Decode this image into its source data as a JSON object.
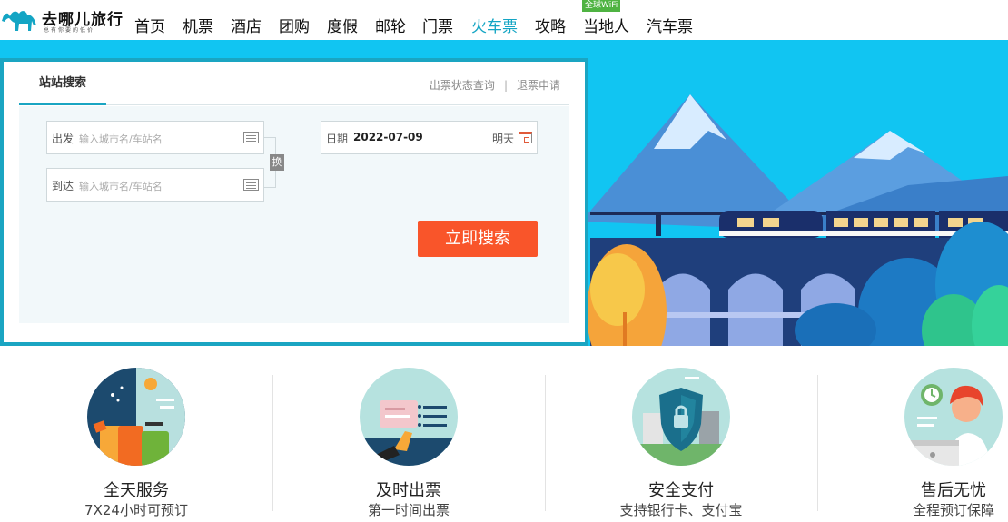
{
  "brand": {
    "name": "去哪儿旅行",
    "slogan": "总有你要的低价"
  },
  "nav": {
    "items": [
      {
        "label": "首页"
      },
      {
        "label": "机票"
      },
      {
        "label": "酒店"
      },
      {
        "label": "团购"
      },
      {
        "label": "度假"
      },
      {
        "label": "邮轮"
      },
      {
        "label": "门票"
      },
      {
        "label": "火车票",
        "active": true
      },
      {
        "label": "攻略"
      },
      {
        "label": "当地人"
      },
      {
        "label": "汽车票"
      }
    ],
    "badge": "全球WiFi"
  },
  "search": {
    "tab_label": "站站搜索",
    "link_status": "出票状态查询",
    "link_separator": "|",
    "link_refund": "退票申请",
    "depart_label": "出发",
    "depart_placeholder": "输入城市名/车站名",
    "arrive_label": "到达",
    "arrive_placeholder": "输入城市名/车站名",
    "swap_label": "换",
    "date_label": "日期",
    "date_value": "2022-07-09",
    "date_tag": "明天",
    "search_button": "立即搜索"
  },
  "features": [
    {
      "title": "全天服务",
      "subtitle": "7X24小时可预订",
      "icon": "luggage-icon"
    },
    {
      "title": "及时出票",
      "subtitle": "第一时间出票",
      "icon": "ticket-hand-icon"
    },
    {
      "title": "安全支付",
      "subtitle": "支持银行卡、支付宝",
      "icon": "shield-icon"
    },
    {
      "title": "售后无忧",
      "subtitle": "全程预订保障",
      "icon": "customer-service-icon"
    }
  ],
  "colors": {
    "accent": "#1aa5c2",
    "active_nav": "#14a5c4",
    "search_button": "#f9552a",
    "banner_sky": "#11c5f2",
    "wifi_badge": "#4fb342"
  }
}
